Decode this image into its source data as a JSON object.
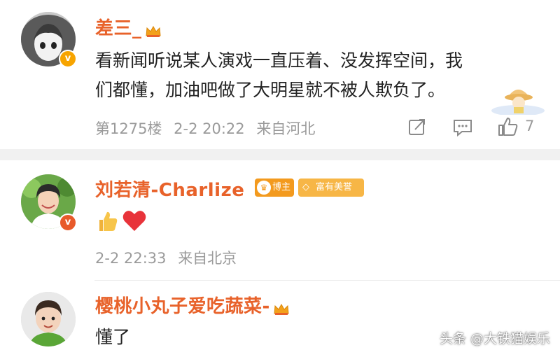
{
  "comments": [
    {
      "username": "差三_",
      "text_line1": "看新闻听说某人演戏一直压着、没发挥空间，我",
      "text_line2": "们都懂，加油吧做了大明星就不被人欺负了。",
      "floor": "第1275楼",
      "time": "2-2 20:22",
      "location": "来自河北",
      "like_count": "7"
    },
    {
      "username": "刘若清-Charlize",
      "badge_blogger": "博主",
      "badge_beauty": "富有美誉",
      "time": "2-2 22:33",
      "location": "来自北京"
    },
    {
      "username": "樱桃小丸子爱吃蔬菜-",
      "text": "懂了"
    }
  ],
  "icons": [
    "crown-icon",
    "verified-icon",
    "share-icon",
    "reply-icon",
    "like-icon",
    "thumbs-up-emoji",
    "red-heart-emoji"
  ],
  "colors": {
    "username": "#e8622a",
    "badge_orange": "#f39a1e",
    "verified": "#f7a400",
    "heart": "#e8333a"
  },
  "watermark": "头条 @大铁猫娱乐"
}
